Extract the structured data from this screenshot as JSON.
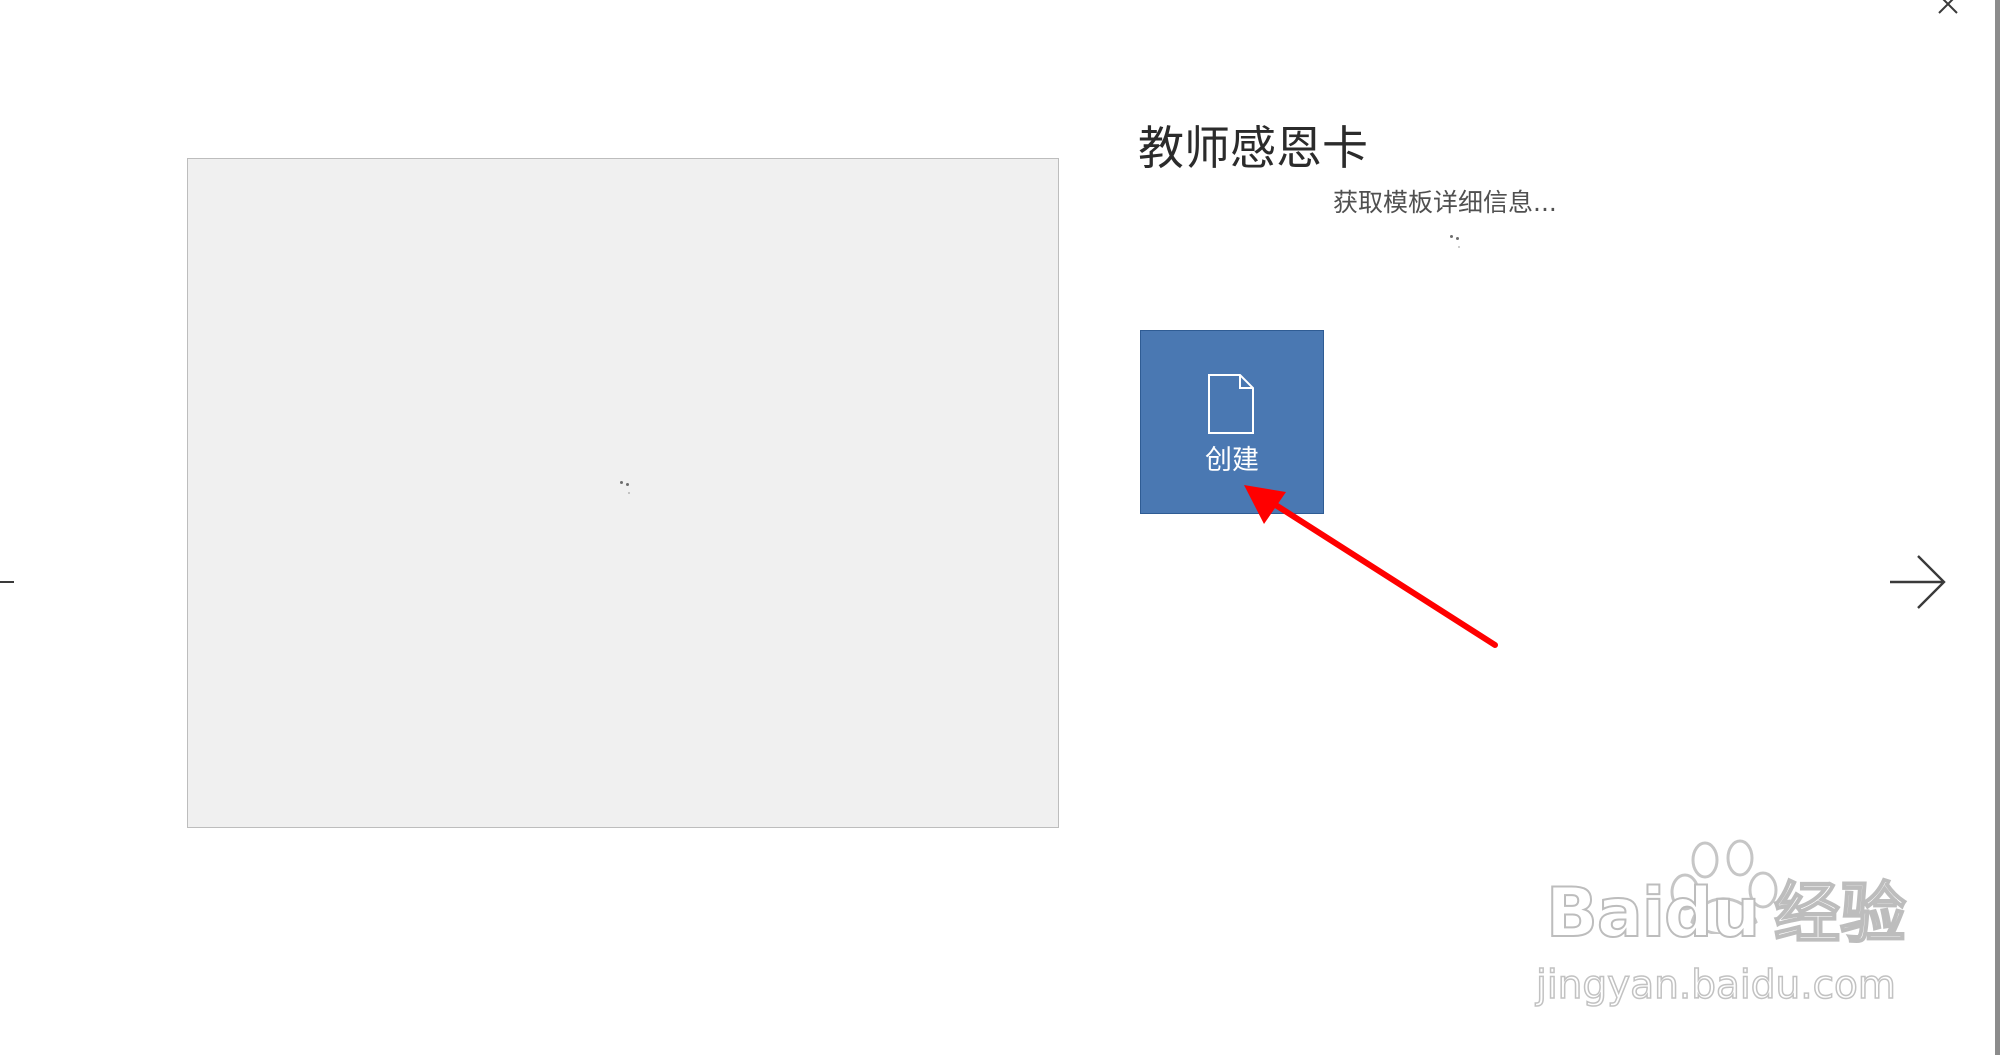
{
  "dialog": {
    "close_icon": "close-icon",
    "prev_icon": "arrow-left-icon",
    "next_icon": "arrow-right-icon",
    "border_color": "#8c8c8c"
  },
  "preview": {
    "background_color": "#f0f0f0",
    "loading_icon": "loading-dots-icon"
  },
  "template": {
    "title": "教师感恩卡",
    "status": "获取模板详细信息...",
    "status_icon": "loading-dots-icon"
  },
  "create_button": {
    "label": "创建",
    "icon": "document-icon",
    "color": "#4a78b2"
  },
  "annotation": {
    "arrow_color": "#ff0000"
  },
  "watermark": {
    "brand": "Baidu",
    "product": "经验",
    "url": "jingyan.baidu.com"
  }
}
